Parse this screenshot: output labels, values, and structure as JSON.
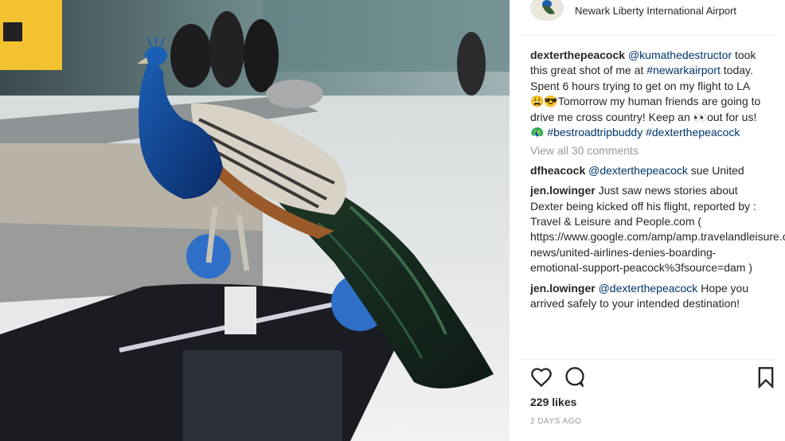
{
  "post": {
    "location": "Newark Liberty International Airport",
    "caption": {
      "user": "dexterthepeacock",
      "mention": "@kumathedestructor",
      "text1": " took this great shot of me at ",
      "hashtag1": "#newarkairport",
      "text2": " today. Spent 6 hours trying to get on my flight to LA 😩😎Tomorrow my human friends are going to drive me cross country! Keep an 👀out for us! 🦚 ",
      "hashtag2": "#bestroadtripbuddy",
      "hashtag3": "#dexterthepeacock"
    },
    "view_all_comments": "View all 30 comments",
    "comments": [
      {
        "user": "dfheacock",
        "mention": "@dexterthepeacock",
        "text": " sue United"
      },
      {
        "user": "jen.lowinger",
        "mention": "",
        "text": " Just saw news stories about Dexter being kicked off his flight, reported by : Travel & Leisure and People.com ( https://www.google.com/amp/amp.travelandleisure.com/travel-news/united-airlines-denies-boarding-emotional-support-peacock%3fsource=dam )"
      },
      {
        "user": "jen.lowinger",
        "mention": "@dexterthepeacock",
        "text": " Hope you arrived safely to your intended destination!"
      }
    ],
    "likes": "229 likes",
    "time_ago": "2 DAYS AGO"
  },
  "icons": {
    "like": "heart-icon",
    "comment": "comment-bubble-icon",
    "save": "bookmark-icon"
  },
  "colors": {
    "link": "#003569",
    "text": "#262626",
    "muted": "#999999"
  }
}
